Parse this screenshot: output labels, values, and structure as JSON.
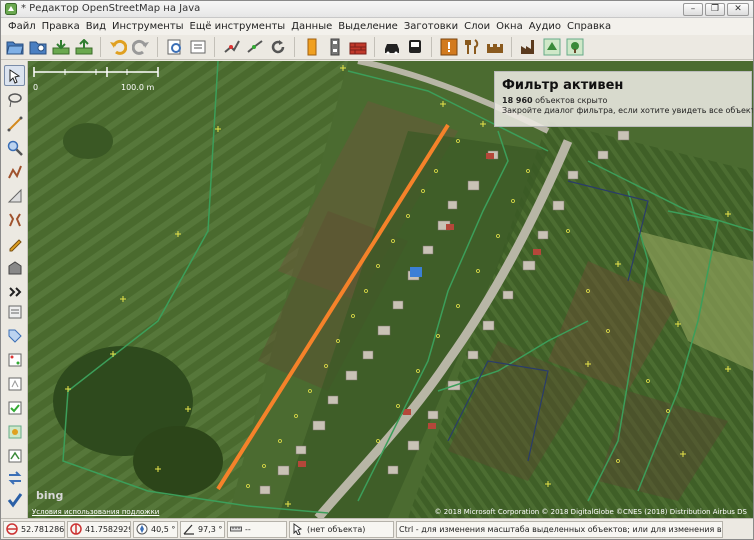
{
  "window": {
    "title": "* Редактор OpenStreetMap на Java",
    "minimize": "–",
    "maximize": "❐",
    "close": "✕"
  },
  "menu": [
    "Файл",
    "Правка",
    "Вид",
    "Инструменты",
    "Ещё инструменты",
    "Данные",
    "Выделение",
    "Заготовки",
    "Слои",
    "Окна",
    "Аудио",
    "Справка"
  ],
  "toolbar_icons": [
    "open-icon",
    "open-location-icon",
    "download-icon",
    "upload-icon",
    "undo-icon",
    "redo-icon",
    "preferences-icon",
    "layers-icon",
    "split-way-icon",
    "combine-way-icon",
    "refresh-icon",
    "traffic-light-icon",
    "railway-icon",
    "wall-icon",
    "car-icon",
    "bus-icon",
    "hazard-icon",
    "restaurant-icon",
    "castle-icon",
    "factory-icon",
    "landuse-icon",
    "park-icon"
  ],
  "map": {
    "scale": {
      "start": "0",
      "end": "100.0 m"
    },
    "filter": {
      "title": "Фильтр активен",
      "hidden_count": "18 960",
      "hidden_text": "объектов скрыто",
      "hint": "Закройте диалог фильтра, если хотите увидеть все объекты."
    },
    "attribution": "© 2018 Microsoft Corporation © 2018 DigitalGlobe ©CNES (2018) Distribution Airbus DS",
    "terms": "Условия использования подложки",
    "bing": "bing"
  },
  "status": {
    "lat": "52.7812867",
    "lon": "41.7582929",
    "heading": "40,5 °",
    "angle": "97,3 °",
    "length": "--",
    "object": "(нет объекта)",
    "hint": "Ctrl - для изменения масштаба выделенных объектов; или для изменения выделения"
  },
  "colors": {
    "accent_orange": "#f5822a",
    "way_green": "#3c9e5a",
    "node_yellow": "#e8e54a"
  }
}
